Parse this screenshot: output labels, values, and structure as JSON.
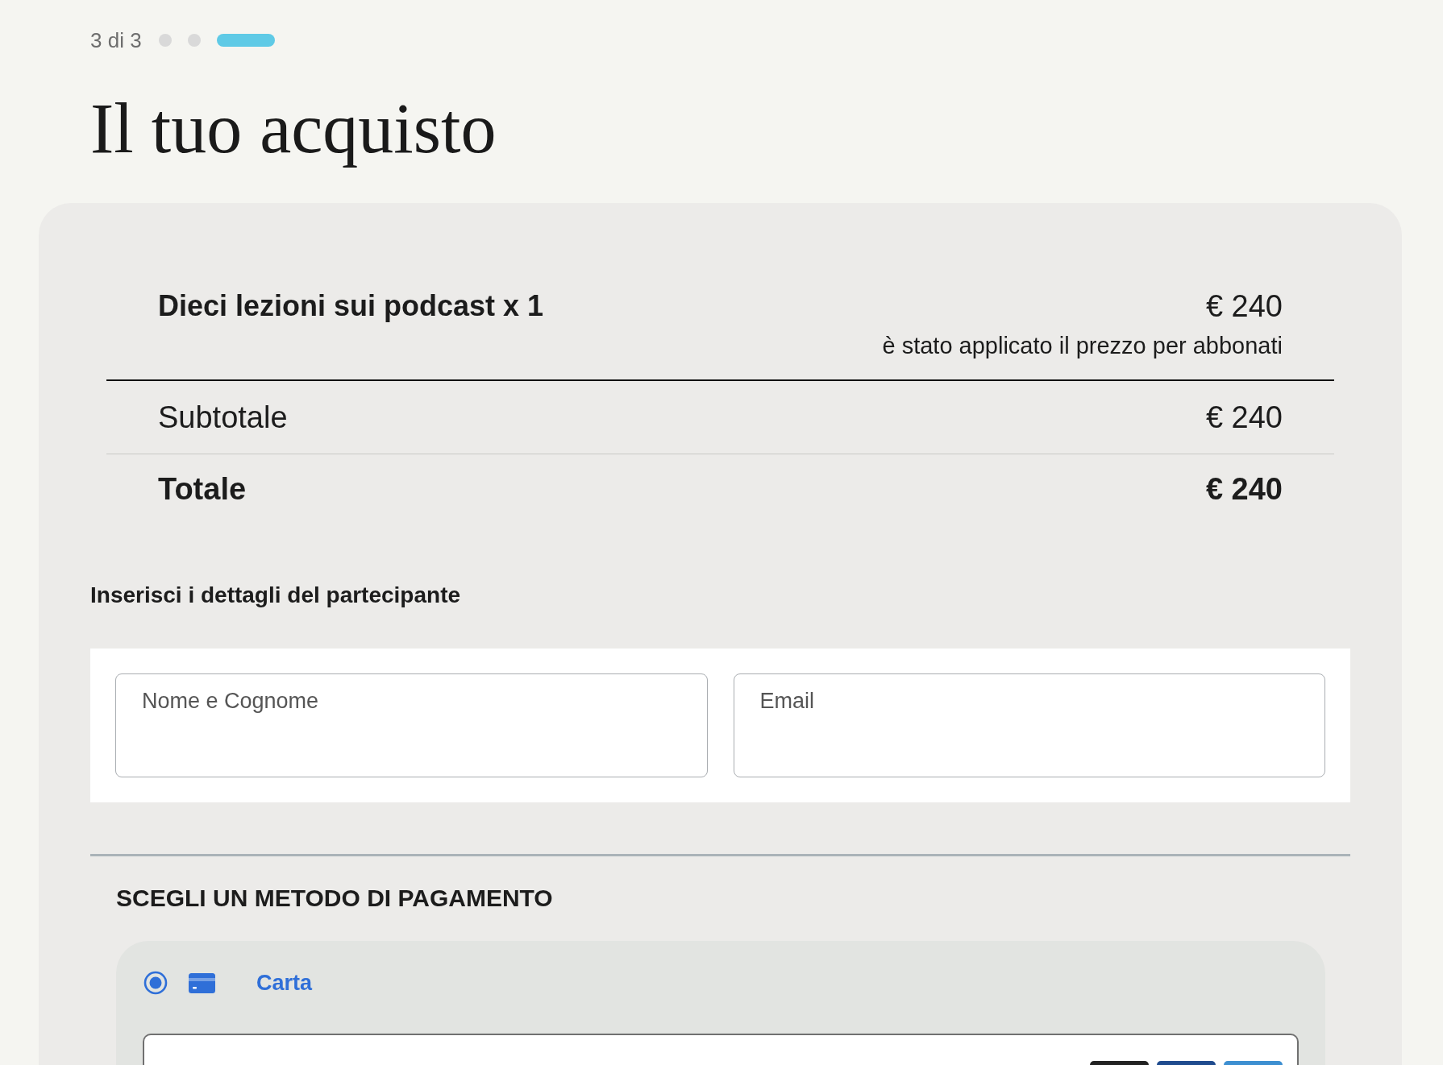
{
  "progress": {
    "label": "3 di 3",
    "steps": [
      {
        "active": false
      },
      {
        "active": false
      },
      {
        "active": true
      }
    ]
  },
  "title": "Il tuo acquisto",
  "order": {
    "items": [
      {
        "name": "Dieci lezioni sui podcast x 1",
        "price": "€ 240",
        "note": "è stato applicato il prezzo per abbonati"
      }
    ],
    "subtotal": {
      "label": "Subtotale",
      "value": "€ 240"
    },
    "total": {
      "label": "Totale",
      "value": "€ 240"
    }
  },
  "participant": {
    "heading": "Inserisci i dettagli del partecipante",
    "fields": [
      {
        "placeholder": "Nome e Cognome"
      },
      {
        "placeholder": "Email"
      }
    ]
  },
  "payment": {
    "heading": "SCEGLI UN METODO DI PAGAMENTO",
    "methods": [
      {
        "label": "Carta",
        "selected": true
      }
    ]
  }
}
